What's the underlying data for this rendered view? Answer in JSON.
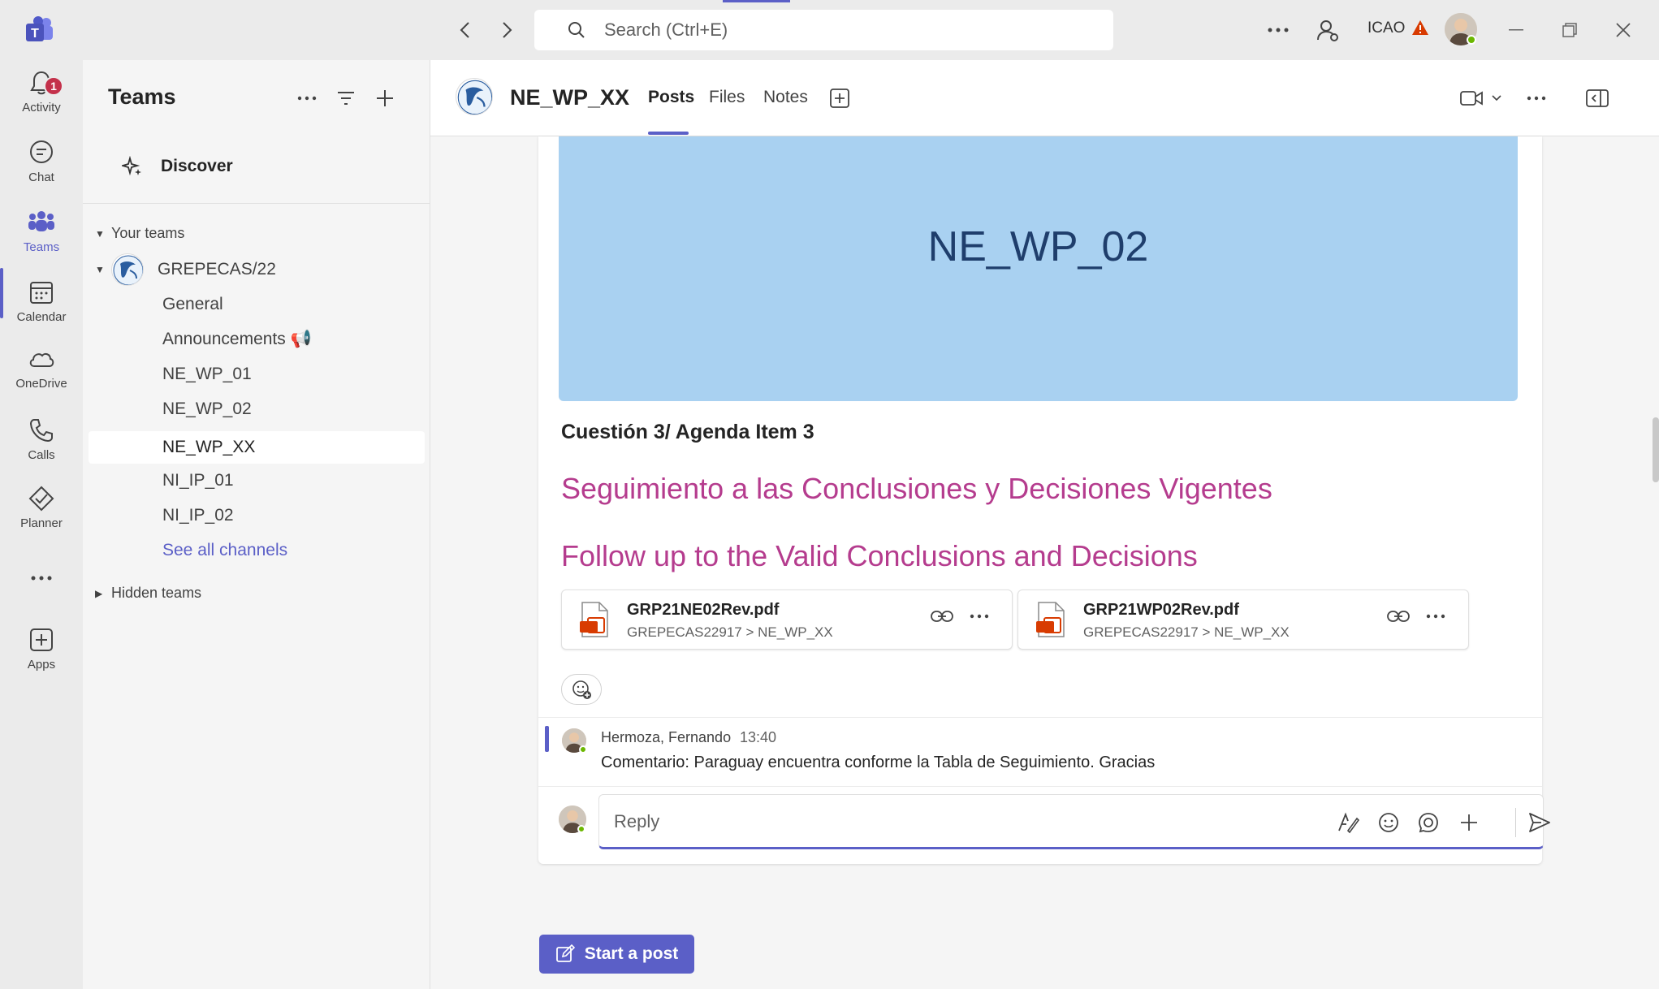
{
  "titlebar": {
    "search_placeholder": "Search (Ctrl+E)",
    "org": "ICAO"
  },
  "appbar": {
    "items": [
      {
        "label": "Activity",
        "icon": "bell-icon",
        "badge": "1"
      },
      {
        "label": "Chat",
        "icon": "chat-icon"
      },
      {
        "label": "Teams",
        "icon": "teams-icon"
      },
      {
        "label": "Calendar",
        "icon": "calendar-icon"
      },
      {
        "label": "OneDrive",
        "icon": "cloud-icon"
      },
      {
        "label": "Calls",
        "icon": "phone-icon"
      },
      {
        "label": "Planner",
        "icon": "planner-icon"
      },
      {
        "label": "",
        "icon": "more-icon"
      },
      {
        "label": "Apps",
        "icon": "apps-icon"
      }
    ]
  },
  "teams_pane": {
    "title": "Teams",
    "discover": "Discover",
    "your_teams": "Your teams",
    "team_name": "GREPECAS/22",
    "channels": [
      {
        "label": "General"
      },
      {
        "label": "Announcements 📢"
      },
      {
        "label": "NE_WP_01"
      },
      {
        "label": "NE_WP_02"
      },
      {
        "label": "NE_WP_XX"
      },
      {
        "label": "NI_IP_01"
      },
      {
        "label": "NI_IP_02"
      }
    ],
    "see_all": "See all channels",
    "hidden_teams": "Hidden teams"
  },
  "channel_header": {
    "title": "NE_WP_XX",
    "tabs": [
      {
        "label": "Posts"
      },
      {
        "label": "Files"
      },
      {
        "label": "Notes"
      }
    ]
  },
  "post": {
    "banner_text": "NE_WP_02",
    "subject": "Cuestión 3/ Agenda Item 3",
    "line_es": "Seguimiento a las Conclusiones y Decisiones Vigentes",
    "line_en": "Follow up to the Valid Conclusions and Decisions",
    "attachments": [
      {
        "name": "GRP21NE02Rev.pdf",
        "path": "GREPECAS22917 > NE_WP_XX"
      },
      {
        "name": "GRP21WP02Rev.pdf",
        "path": "GREPECAS22917 > NE_WP_XX"
      }
    ]
  },
  "reply": {
    "author": "Hermoza, Fernando",
    "time": "13:40",
    "text": "Comentario: Paraguay encuentra conforme la Tabla de Seguimiento. Gracias"
  },
  "compose": {
    "placeholder": "Reply"
  },
  "start_post": "Start a post",
  "colors": {
    "accent": "#5b5fc7",
    "banner": "#a9d1f1",
    "pink_text": "#b53c8e",
    "alert": "#c4314b"
  }
}
